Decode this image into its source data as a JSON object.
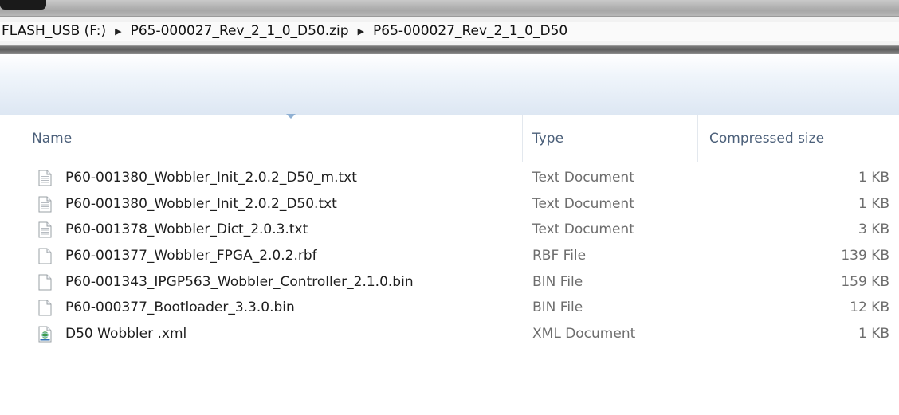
{
  "address_bar": {
    "crumbs": [
      "FLASH_USB (F:)",
      "P65-000027_Rev_2_1_0_D50.zip",
      "P65-000027_Rev_2_1_0_D50"
    ],
    "separator_icon": "chevron-right-icon"
  },
  "columns": {
    "name": "Name",
    "type": "Type",
    "compressed_size": "Compressed size"
  },
  "files": [
    {
      "name": "P60-001380_Wobbler_Init_2.0.2_D50_m.txt",
      "type": "Text Document",
      "size": "1 KB",
      "icon": "text-file-icon"
    },
    {
      "name": "P60-001380_Wobbler_Init_2.0.2_D50.txt",
      "type": "Text Document",
      "size": "1 KB",
      "icon": "text-file-icon"
    },
    {
      "name": "P60-001378_Wobbler_Dict_2.0.3.txt",
      "type": "Text Document",
      "size": "3 KB",
      "icon": "text-file-icon"
    },
    {
      "name": "P60-001377_Wobbler_FPGA_2.0.2.rbf",
      "type": "RBF File",
      "size": "139 KB",
      "icon": "blank-file-icon"
    },
    {
      "name": "P60-001343_IPGP563_Wobbler_Controller_2.1.0.bin",
      "type": "BIN File",
      "size": "159 KB",
      "icon": "blank-file-icon"
    },
    {
      "name": "P60-000377_Bootloader_3.3.0.bin",
      "type": "BIN File",
      "size": "12 KB",
      "icon": "blank-file-icon"
    },
    {
      "name": "D50 Wobbler .xml",
      "type": "XML Document",
      "size": "1 KB",
      "icon": "xml-file-icon"
    }
  ]
}
